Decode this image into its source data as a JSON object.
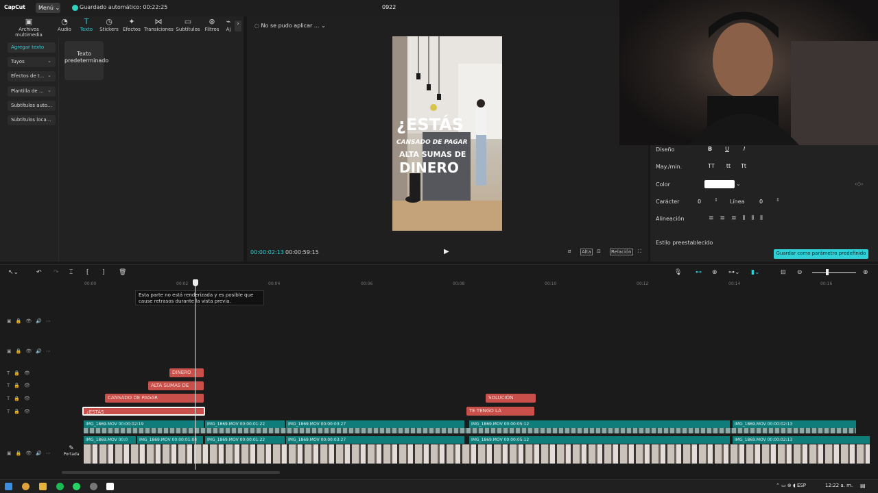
{
  "app": {
    "logo": "CapCut",
    "menu_label": "Menú",
    "autosave": "Guardado automático: 00:22:25",
    "project_title": "0922"
  },
  "toolbar": {
    "tabs": [
      {
        "label": "Archivos multimedia",
        "icon": "media-icon"
      },
      {
        "label": "Audio",
        "icon": "audio-icon"
      },
      {
        "label": "Texto",
        "icon": "text-icon",
        "active": true
      },
      {
        "label": "Stickers",
        "icon": "sticker-icon"
      },
      {
        "label": "Efectos",
        "icon": "effects-icon"
      },
      {
        "label": "Transiciones",
        "icon": "transition-icon"
      },
      {
        "label": "Subtítulos",
        "icon": "subtitles-icon"
      },
      {
        "label": "Filtros",
        "icon": "filter-icon"
      },
      {
        "label": "Aj",
        "icon": "adjust-icon"
      }
    ]
  },
  "sidebar": {
    "items": [
      {
        "label": "Agregar texto",
        "active": true
      },
      {
        "label": "Tuyos"
      },
      {
        "label": "Efectos de t..."
      },
      {
        "label": "Plantilla de ..."
      },
      {
        "label": "Subtítulos auto..."
      },
      {
        "label": "Subtítulos loca..."
      }
    ]
  },
  "preset_card": {
    "label": "Texto predeterminado"
  },
  "player": {
    "status": "No se pudo aplicar ...",
    "overlay_lines": [
      "¿ESTÁS",
      "CANSADO DE PAGAR",
      "ALTA SUMAS DE",
      "DINERO"
    ],
    "time_current": "00:00:02:13",
    "time_total": "00:00:59:15",
    "quality_label": "Alta",
    "ratio_label": "Relación"
  },
  "properties": {
    "design_label": "Diseño",
    "case_label": "May./min.",
    "case_options": [
      "TT",
      "tt",
      "Tt"
    ],
    "color_label": "Color",
    "color_value": "#ffffff",
    "char_label": "Carácter",
    "char_value": "0",
    "line_label": "Línea",
    "line_value": "0",
    "align_label": "Alineación",
    "preset_label": "Estilo preestablecido",
    "save_preset": "Guardar como parámetro predefinido"
  },
  "timeline": {
    "ruler_ticks": [
      "00:00",
      "00:02",
      "00:04",
      "00:06",
      "00:08",
      "00:10",
      "00:12",
      "00:14",
      "00:16"
    ],
    "tooltip": "Esta parte no está renderizada y es posible que cause retrasos durante la vista previa.",
    "text_clips": [
      {
        "label": "DINERO"
      },
      {
        "label": "ALTA SUMAS DE"
      },
      {
        "label": "CANSADO DE PAGAR"
      },
      {
        "label": "¿ESTÁS"
      },
      {
        "label": "SOLUCIÓN"
      },
      {
        "label": "TE TENGO LA"
      }
    ],
    "overlay_clips": [
      {
        "label": "IMG_1869.MOV 00:00:02:19"
      },
      {
        "label": "IMG_1869.MOV 00:00:01:22"
      },
      {
        "label": "IMG_1869.MOV 00:00:03:27"
      },
      {
        "label": "IMG_1869.MOV 00:00:05:12"
      },
      {
        "label": "IMG_1869.MOV 00:00:02:13"
      }
    ],
    "main_clips": [
      {
        "label": "IMG_1869.MOV 00:0"
      },
      {
        "label": "IMG_1869.MOV 00:00:01:04"
      },
      {
        "label": "IMG_1869.MOV 00:00:01:22"
      },
      {
        "label": "IMG_1869.MOV 00:00:03:27"
      },
      {
        "label": "IMG_1869.MOV 00:00:05:12"
      },
      {
        "label": "IMG_1869.MOV 00:00:02:13"
      }
    ],
    "cover_label": "Portada"
  },
  "taskbar": {
    "language": "ESP",
    "clock": "12:22 a. m."
  }
}
